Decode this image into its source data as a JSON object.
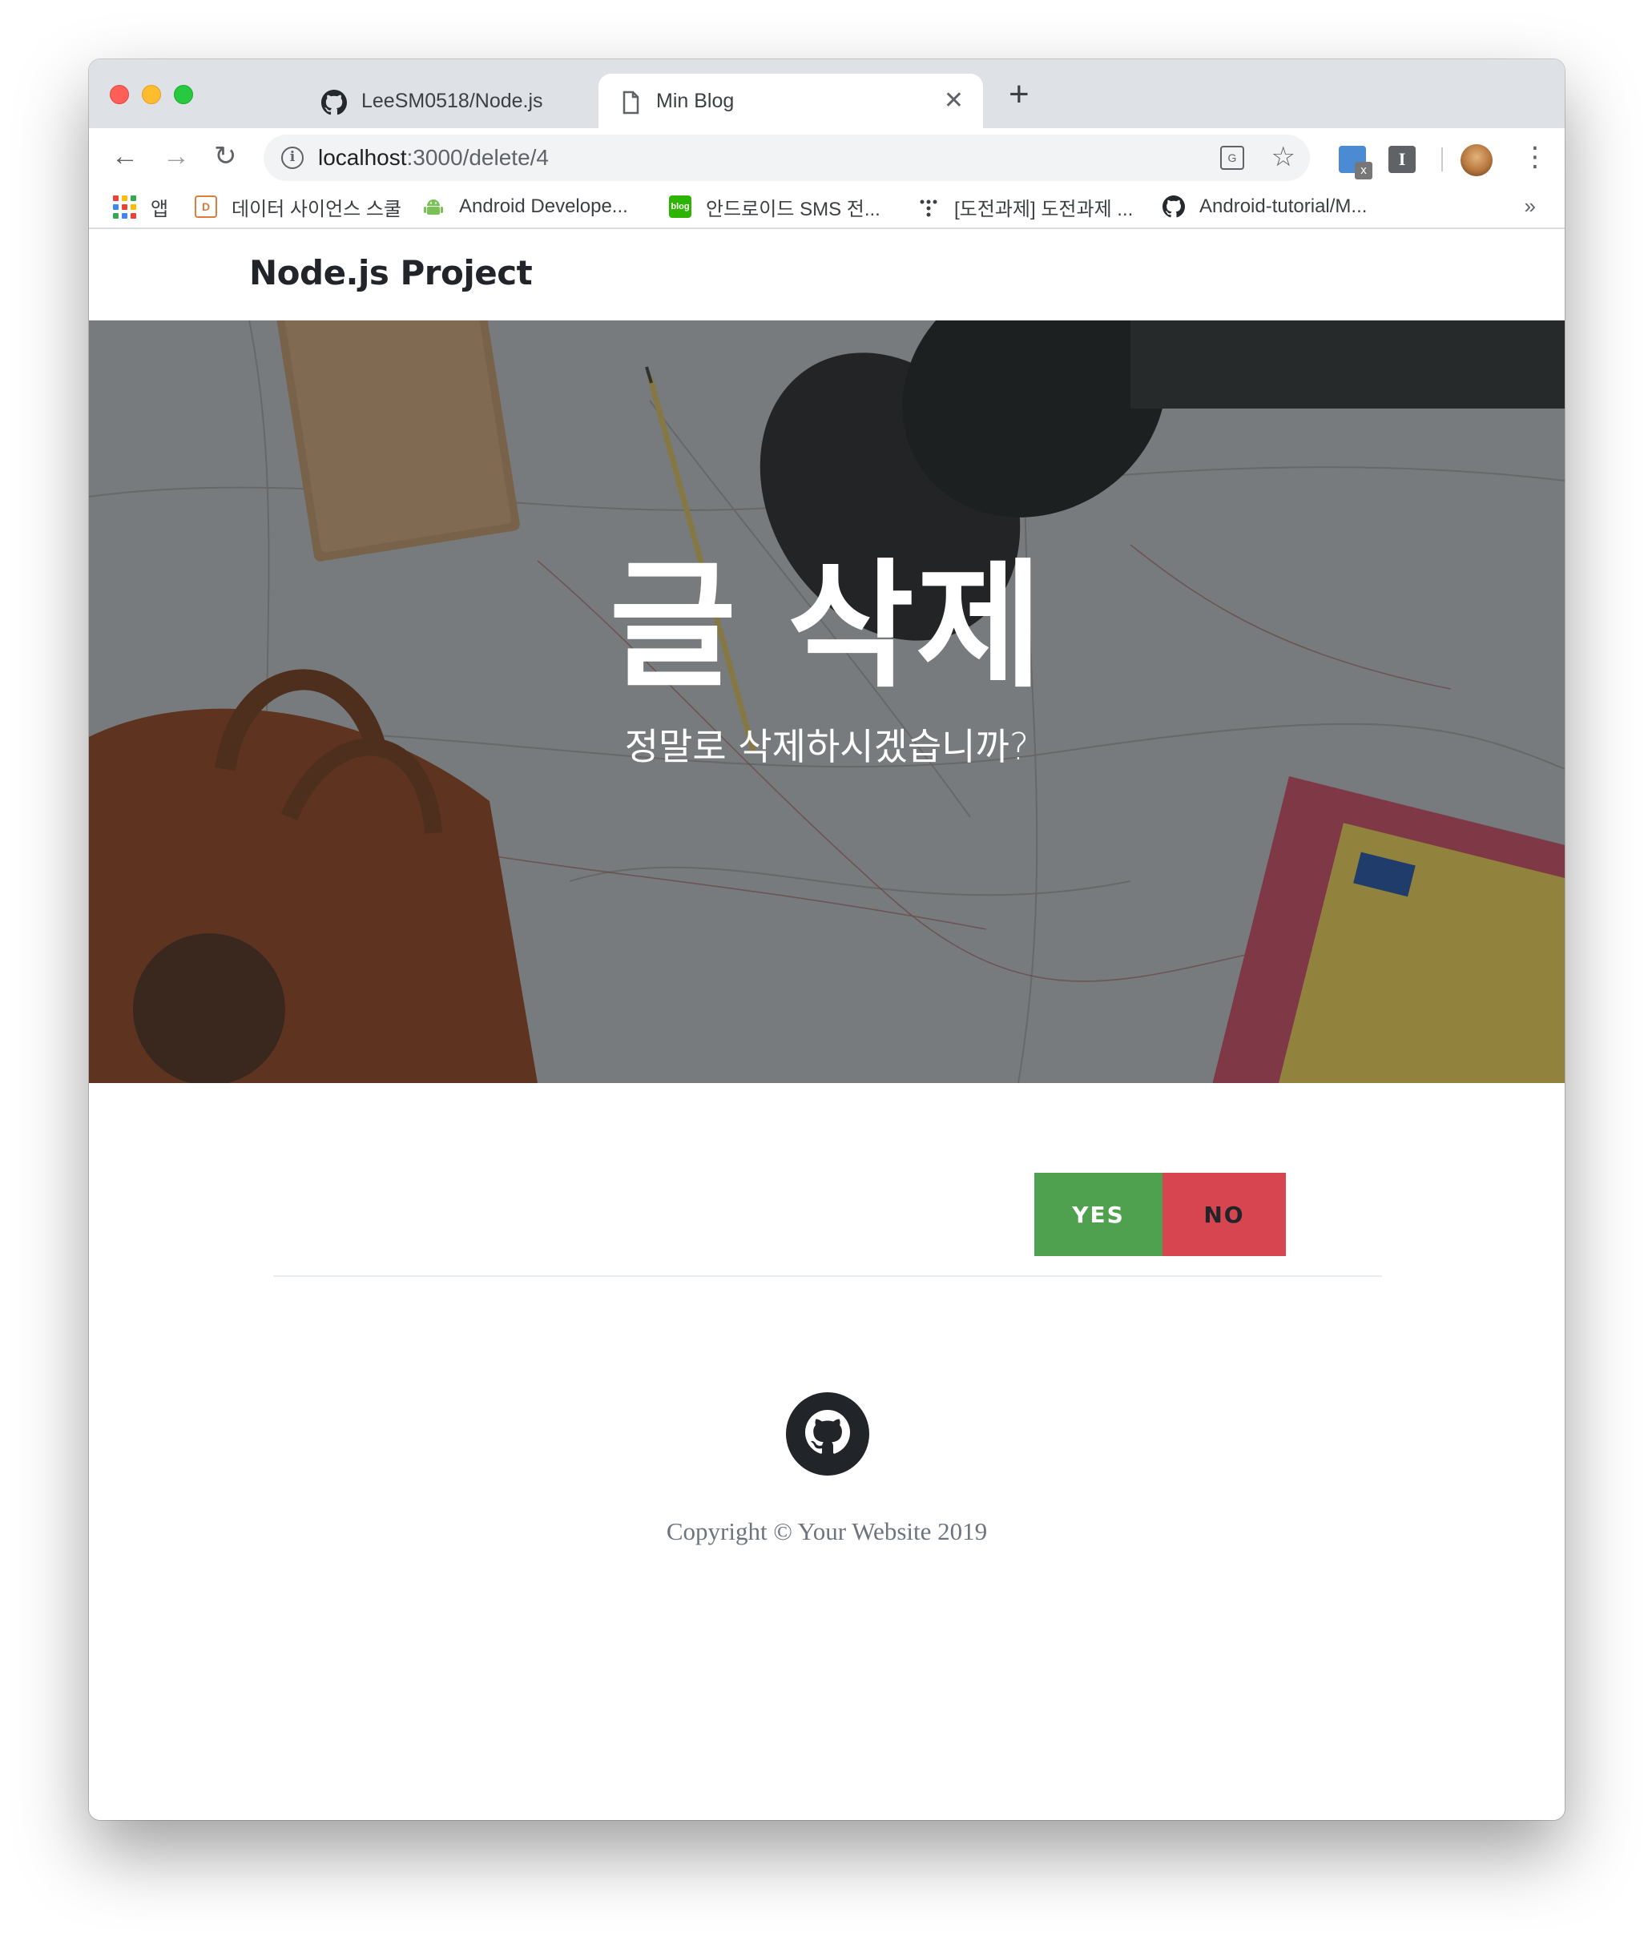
{
  "browser": {
    "tabs": [
      {
        "title": "LeeSM0518/Node.js",
        "icon": "github-icon",
        "active": false,
        "close": "✕"
      },
      {
        "title": "Min Blog",
        "icon": "page-icon",
        "active": true,
        "close": "✕"
      }
    ],
    "new_tab": "+",
    "nav": {
      "back": "←",
      "forward": "→",
      "reload": "↻"
    },
    "address": {
      "host": "localhost",
      "path": ":3000/delete/4"
    },
    "toolbar_icons": [
      "translate-icon",
      "bookmark-star-icon",
      "screenshot-extension-icon",
      "instapaper-extension-icon",
      "profile-avatar",
      "menu-icon"
    ],
    "bookmarks": [
      {
        "label": "앱",
        "icon": "apps-grid-icon"
      },
      {
        "label": "데이터 사이언스 스쿨",
        "icon": "datascienceschool-icon"
      },
      {
        "label": "Android Develope...",
        "icon": "android-icon"
      },
      {
        "label": "안드로이드 SMS 전...",
        "icon": "naver-blog-icon"
      },
      {
        "label": "[도전과제] 도전과제 ...",
        "icon": "dots-icon"
      },
      {
        "label": "Android-tutorial/M...",
        "icon": "github-icon"
      }
    ],
    "bookmarks_more": "»"
  },
  "site": {
    "brand": "Node.js Project",
    "hero": {
      "title": "글 삭제",
      "subtitle": "정말로 삭제하시겠습니까?"
    },
    "actions": {
      "yes": "YES",
      "no": "NO"
    },
    "footer": {
      "social_icon": "github-icon",
      "copyright": "Copyright © Your Website 2019"
    }
  },
  "colors": {
    "yes_button": "#4fa14f",
    "no_button": "#d64550",
    "text_dark": "#212529",
    "footer_text": "#6c757d"
  }
}
